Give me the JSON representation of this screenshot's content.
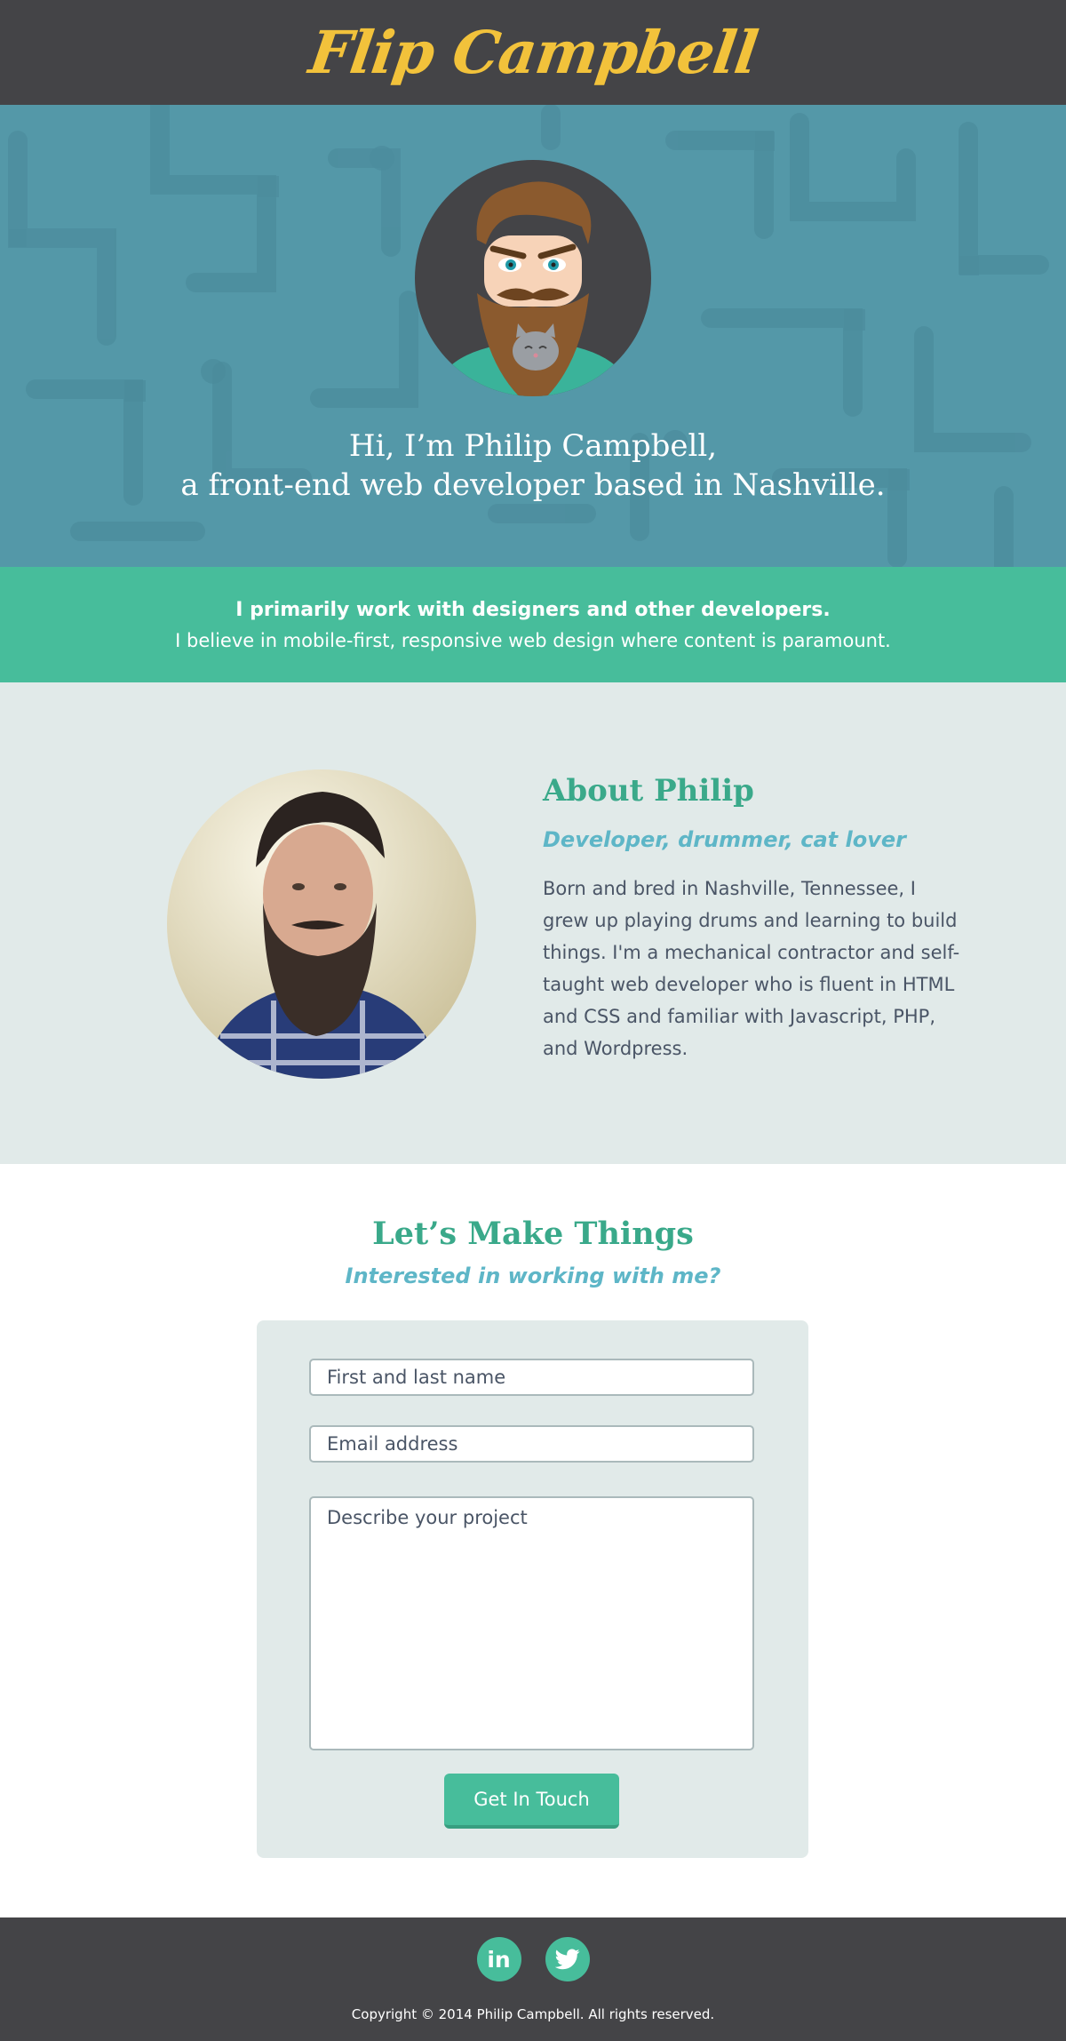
{
  "header": {
    "logo_text": "Flip Campbell"
  },
  "hero": {
    "line1": "Hi, I’m Philip Campbell,",
    "line2": "a front-end web developer based in Nashville."
  },
  "intro": {
    "strong": "I primarily work with designers and other developers.",
    "light": "I believe in mobile-first, responsive web design where content is paramount."
  },
  "about": {
    "title": "About Philip",
    "subtitle": "Developer, drummer, cat lover",
    "body": "Born and bred in Nashville, Tennessee, I grew up playing drums and learning to build things. I'm a mechanical contractor and self-taught web developer who is fluent in HTML and CSS and familiar with Javascript, PHP, and Wordpress."
  },
  "contact": {
    "title": "Let’s Make Things",
    "subtitle": "Interested in working with me?",
    "name_placeholder": "First and last name",
    "email_placeholder": "Email address",
    "project_placeholder": "Describe your project",
    "submit_label": "Get In Touch"
  },
  "footer": {
    "socials": [
      {
        "icon": "linkedin-icon",
        "glyph": "in"
      },
      {
        "icon": "twitter-icon"
      }
    ],
    "copyright": "Copyright © 2014 Philip Campbell. All rights reserved."
  },
  "colors": {
    "header_bg": "#444447",
    "logo": "#f2c23b",
    "hero_bg": "#5498a8",
    "accent_green": "#47bd9b",
    "title_green": "#3aa98a",
    "subtitle_blue": "#5eb6c7",
    "section_bg": "#e1eae9"
  }
}
